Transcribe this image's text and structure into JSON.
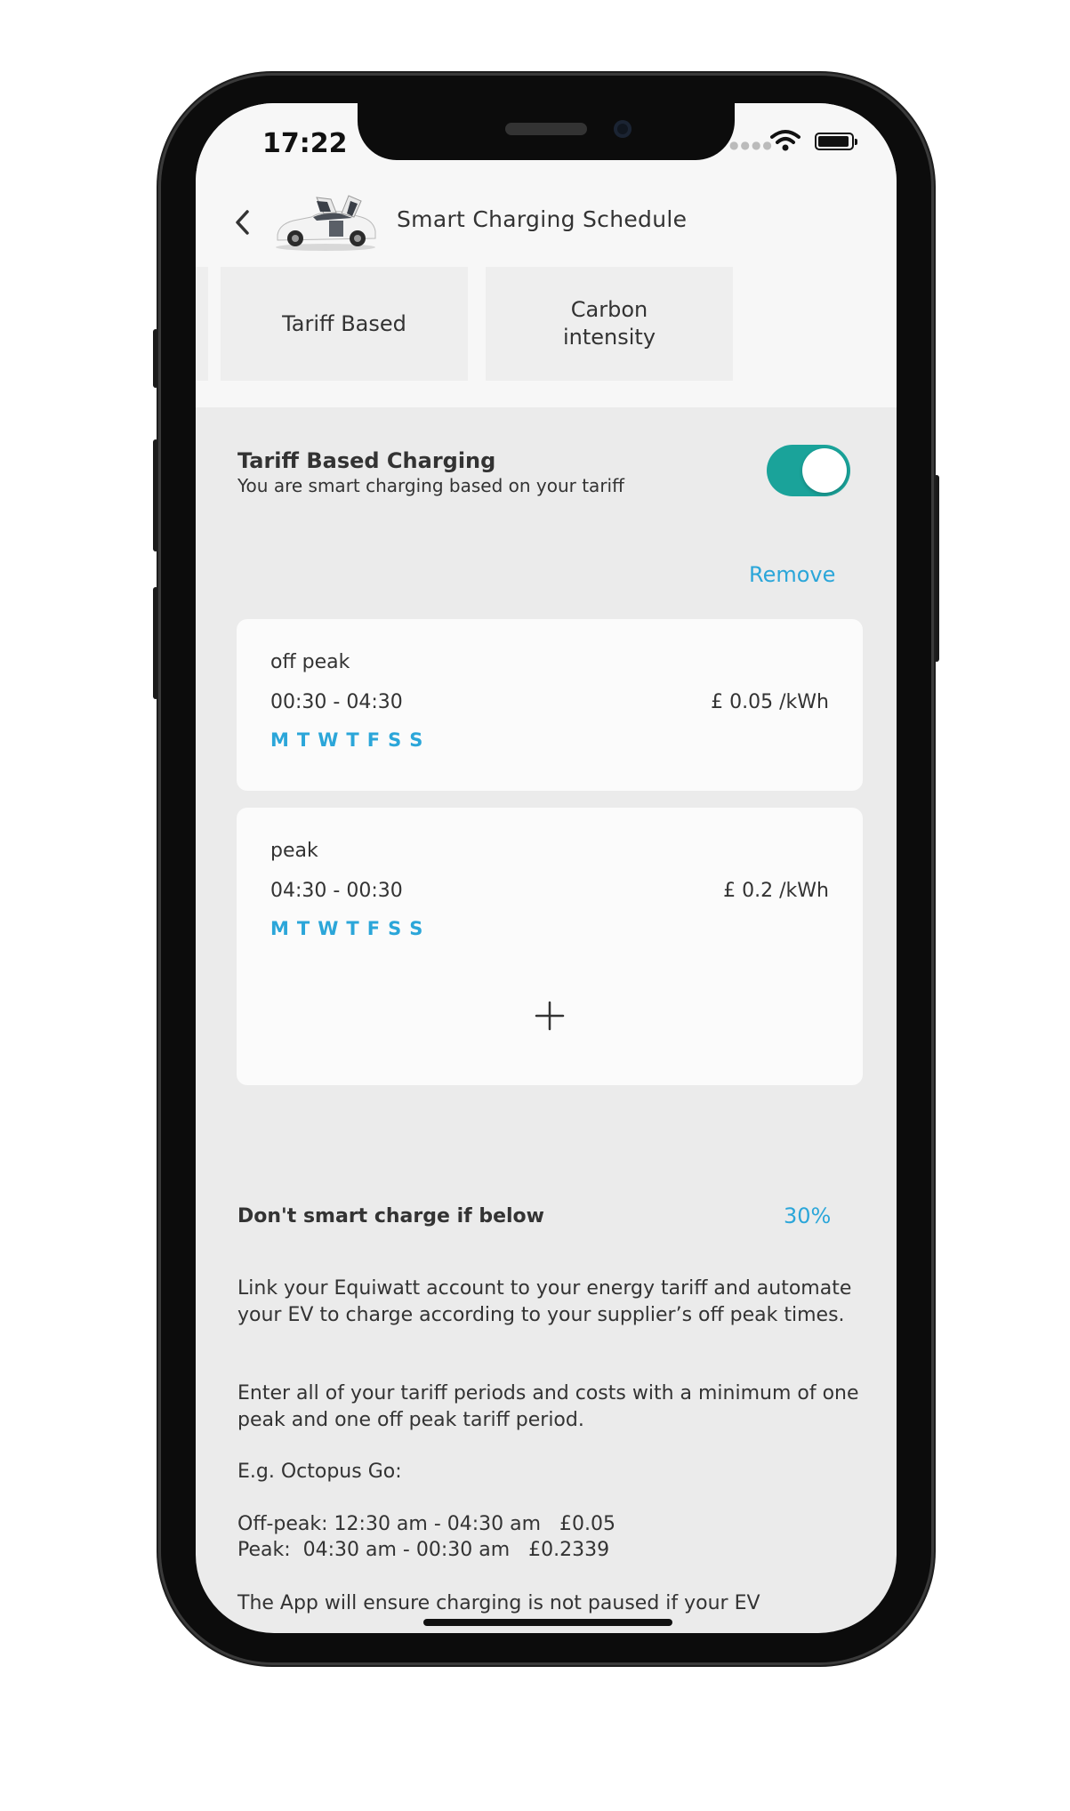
{
  "status_bar": {
    "time": "17:22"
  },
  "header": {
    "title": "Smart Charging Schedule"
  },
  "tabs": [
    {
      "label": "Tariff Based"
    },
    {
      "label": "Carbon\nintensity"
    }
  ],
  "tariff_section": {
    "title": "Tariff Based Charging",
    "subtitle": "You are smart charging based on your tariff",
    "toggle_on": true,
    "remove_label": "Remove"
  },
  "periods": [
    {
      "name": "off peak",
      "time": "00:30 - 04:30",
      "price": "£ 0.05 /kWh",
      "days": [
        "M",
        "T",
        "W",
        "T",
        "F",
        "S",
        "S"
      ]
    },
    {
      "name": "peak",
      "time": "04:30 - 00:30",
      "price": "£ 0.2 /kWh",
      "days": [
        "M",
        "T",
        "W",
        "T",
        "F",
        "S",
        "S"
      ]
    }
  ],
  "add_period": {
    "icon": "plus-icon"
  },
  "threshold": {
    "label": "Don't smart charge if below",
    "value": "30%"
  },
  "info": {
    "p1": "Link your Equiwatt account to your energy tariff and automate your EV to charge according to your supplier’s off peak times.",
    "p2": "Enter all of your tariff periods and costs with a minimum of one peak and one off peak tariff period.",
    "p3": "E.g. Octopus Go:",
    "p4_line1": "Off-peak: 12:30 am - 04:30 am   £0.05",
    "p4_line2": "Peak:  04:30 am - 00:30 am   £0.2339",
    "p5": "The App will ensure charging is not paused if your EV"
  },
  "colors": {
    "accent": "#2ba6d9",
    "toggle": "#1aa39a",
    "background": "#ebebeb",
    "card": "#fbfbfb"
  }
}
